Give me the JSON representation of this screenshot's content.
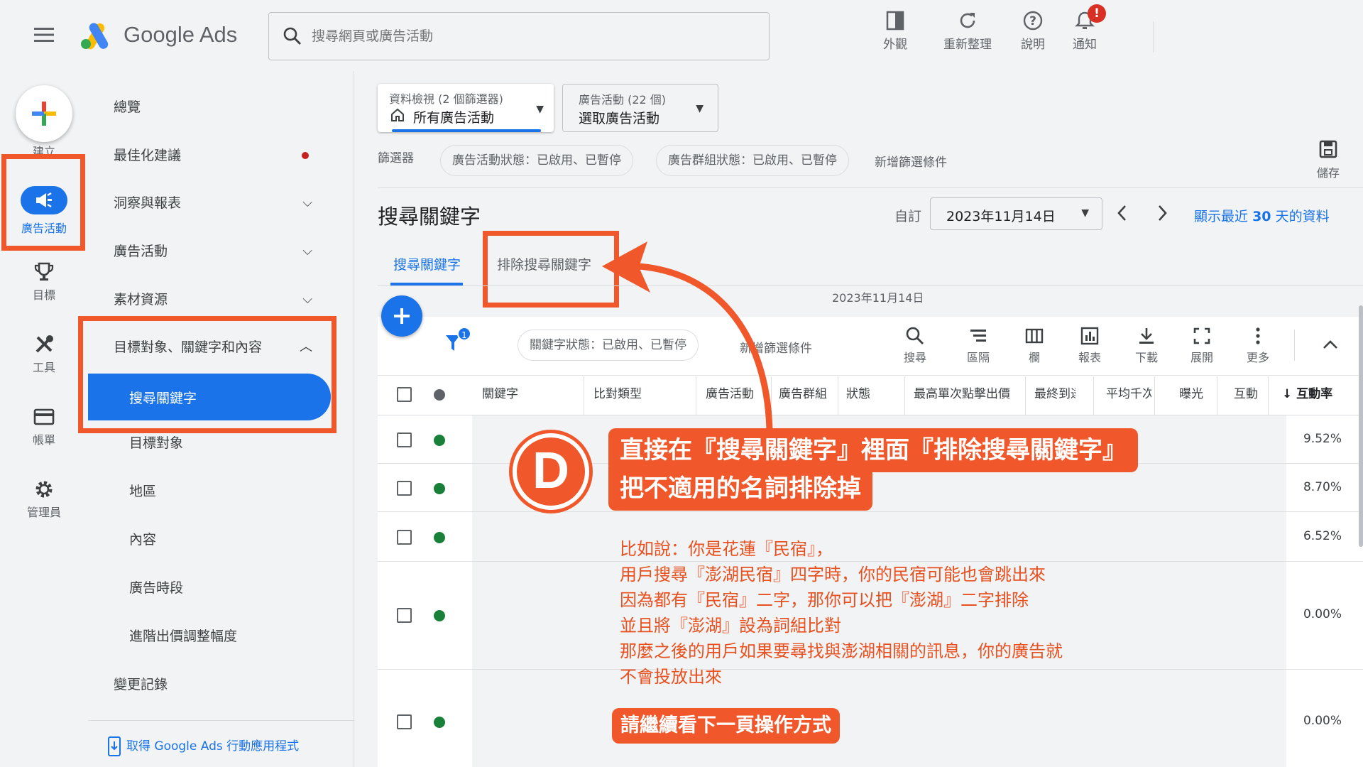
{
  "header": {
    "app_name": "Google Ads",
    "search_placeholder": "搜尋網頁或廣告活動",
    "actions": [
      {
        "label": "外觀",
        "icon": "appearance-icon"
      },
      {
        "label": "重新整理",
        "icon": "refresh-icon"
      },
      {
        "label": "說明",
        "icon": "help-icon"
      },
      {
        "label": "通知",
        "icon": "bell-icon",
        "badge": "!"
      }
    ]
  },
  "rail": {
    "create_label": "建立",
    "items": [
      {
        "label": "廣告活動",
        "icon": "megaphone-icon",
        "active": true
      },
      {
        "label": "目標",
        "icon": "trophy-icon"
      },
      {
        "label": "工具",
        "icon": "tools-icon"
      },
      {
        "label": "帳單",
        "icon": "card-icon"
      },
      {
        "label": "管理員",
        "icon": "gear-icon"
      }
    ]
  },
  "nav": {
    "overview": "總覽",
    "recommendations": "最佳化建議",
    "insights": "洞察與報表",
    "campaigns": "廣告活動",
    "assets": "素材資源",
    "audiences_keywords": "目標對象、關鍵字和內容",
    "search_keywords": "搜尋關鍵字",
    "audiences": "目標對象",
    "locations": "地區",
    "content": "內容",
    "ad_schedule": "廣告時段",
    "bid_adjustments": "進階出價調整幅度",
    "change_history": "變更記錄",
    "mobile_app": "取得 Google Ads 行動應用程式"
  },
  "selectors": {
    "view_caption": "資料檢視 (2 個篩選器)",
    "view_value": "所有廣告活動",
    "campaign_caption": "廣告活動 (22 個)",
    "campaign_value": "選取廣告活動"
  },
  "filters": {
    "label": "篩選器",
    "chips": [
      "廣告活動狀態：已啟用、已暫停",
      "廣告群組狀態：已啟用、已暫停"
    ],
    "add": "新增篩選條件",
    "save": "儲存"
  },
  "page": {
    "title": "搜尋關鍵字",
    "date_mode": "自訂",
    "date_value": "2023年11月14日",
    "show_last_label": "顯示最近",
    "show_last_num": "30",
    "show_last_suffix": "天的資料",
    "tabs": [
      "搜尋關鍵字",
      "排除搜尋關鍵字"
    ],
    "date_subtitle": "2023年11月14日"
  },
  "table_toolbar": {
    "filter_count": "1",
    "chip": "關鍵字狀態：已啟用、已暫停",
    "add_filter": "新增篩選條件",
    "tools": [
      {
        "label": "搜尋",
        "icon": "search-icon"
      },
      {
        "label": "區隔",
        "icon": "segment-icon"
      },
      {
        "label": "欄",
        "icon": "columns-icon"
      },
      {
        "label": "報表",
        "icon": "report-icon"
      },
      {
        "label": "下載",
        "icon": "download-icon"
      },
      {
        "label": "展開",
        "icon": "expand-icon"
      },
      {
        "label": "更多",
        "icon": "more-icon"
      }
    ]
  },
  "table": {
    "columns": [
      "關鍵字",
      "比對類型",
      "廣告活動",
      "廣告群組",
      "狀態",
      "最高單次點擊出價",
      "最終到達網址",
      "平均千次曝光",
      "曝光",
      "互動",
      "互動率"
    ],
    "sort_indicator": "↓",
    "rates": [
      "9.52%",
      "8.70%",
      "6.52%",
      "0.00%",
      "0.00%"
    ]
  },
  "annotation": {
    "badge": "D",
    "headline_1": "直接在『搜尋關鍵字』裡面『排除搜尋關鍵字』",
    "headline_2": "把不適用的名詞排除掉",
    "lines": [
      "比如說：你是花蓮『民宿』，",
      "用戶搜尋『澎湖民宿』四字時，你的民宿可能也會跳出來",
      "因為都有『民宿』二字，那你可以把『澎湖』二字排除",
      "並且將『澎湖』設為詞組比對",
      "那麼之後的用戶如果要尋找與澎湖相關的訊息，你的廣告就",
      "不會投放出來"
    ],
    "footer": "請繼續看下一頁操作方式",
    "color": "#f0582b"
  }
}
